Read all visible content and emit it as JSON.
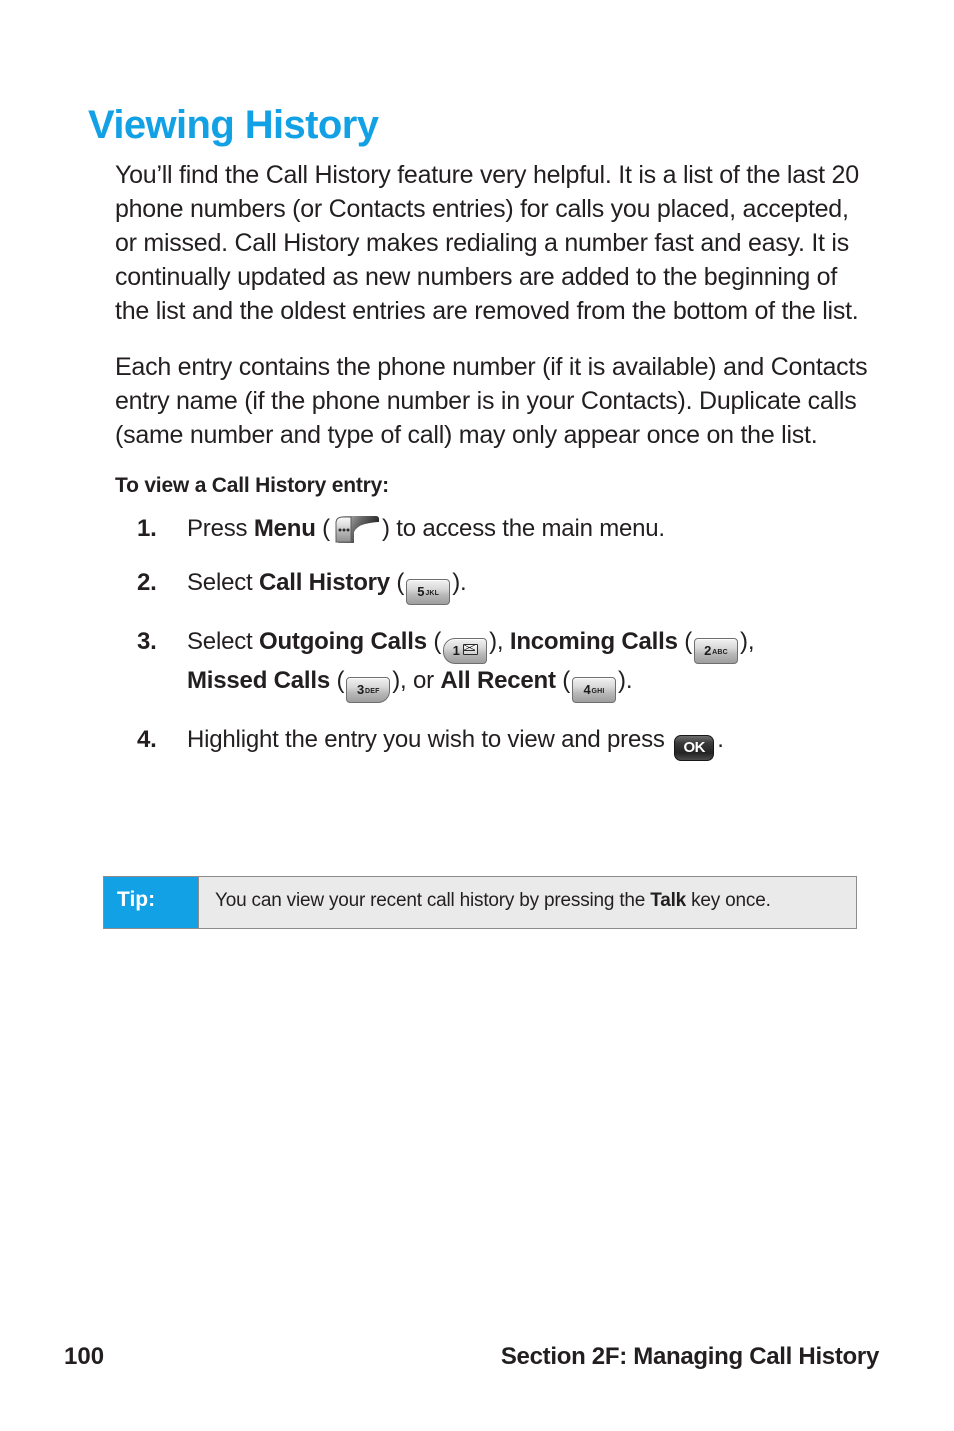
{
  "theme": {
    "accent_blue": "#12a1e5",
    "text_color": "#231f20",
    "tip_background": "#eaeaea",
    "tip_border": "#8c8c8c"
  },
  "title": "Viewing History",
  "paragraphs": [
    "You’ll find the Call History feature very helpful. It is a list of the last 20 phone numbers (or Contacts entries) for calls you placed, accepted, or missed. Call History makes redialing a number fast and easy. It is continually updated as new numbers are added to the beginning of the list and the oldest entries are removed from the bottom of the list.",
    "Each entry contains the phone number (if it is available) and Contacts entry name (if the phone number is in your Contacts). Duplicate calls (same number and type of call) may only appear once on the list."
  ],
  "subhead": "To view a Call History entry:",
  "steps": [
    {
      "number": "1.",
      "pre": "Press ",
      "bold1": "Menu",
      "mid": " (",
      "icon": "menu-softkey-icon",
      "post": ") to access the main menu."
    },
    {
      "number": "2.",
      "pre": "Select ",
      "bold1": "Call History",
      "mid": " (",
      "key_digit": "5",
      "key_letters": "JKL",
      "post": ")."
    },
    {
      "number": "3.",
      "pre": "Select ",
      "bold1": "Outgoing Calls",
      "mid": " (",
      "key1_digit": "1",
      "key1_glyph": "voicemail-envelope-icon",
      "sep1": "), ",
      "bold2": "Incoming Calls",
      "mid2": " (",
      "key2_digit": "2",
      "key2_letters": "ABC",
      "sep2": "),",
      "bold3": "Missed Calls",
      "mid3": " (",
      "key3_digit": "3",
      "key3_letters": "DEF",
      "sep3": "), or ",
      "bold4": "All Recent",
      "mid4": " (",
      "key4_digit": "4",
      "key4_letters": "GHI",
      "post": ")."
    },
    {
      "number": "4.",
      "pre": "Highlight the entry you wish to view and press ",
      "key_ok": "OK",
      "post": "."
    }
  ],
  "tip": {
    "label": "Tip:",
    "text_before": "You can view your recent call history by pressing the ",
    "bold": "Talk",
    "text_after": " key once."
  },
  "footer": {
    "page_number": "100",
    "section": "Section 2F: Managing Call History"
  }
}
